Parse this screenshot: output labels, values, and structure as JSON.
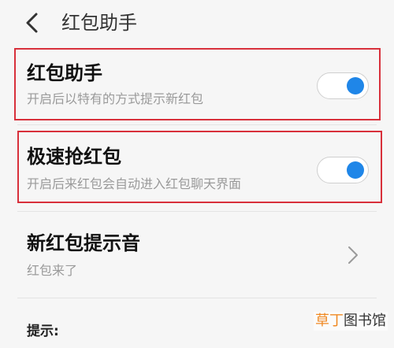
{
  "header": {
    "title": "红包助手"
  },
  "settings": [
    {
      "title": "红包助手",
      "subtitle": "开启后以特有的方式提示新红包",
      "toggle_on": true
    },
    {
      "title": "极速抢红包",
      "subtitle": "开启后来红包会自动进入红包聊天界面",
      "toggle_on": true
    },
    {
      "title": "新红包提示音",
      "subtitle": "红包来了"
    }
  ],
  "tip": {
    "label": "提示:"
  },
  "watermark": {
    "accent_text": "草丁",
    "rest_text": "图书馆"
  },
  "colors": {
    "highlight_border": "#d8303b",
    "toggle_knob": "#1f86e8",
    "watermark_accent": "#f08a24"
  },
  "icons": {
    "back": "chevron-left-icon",
    "next": "chevron-right-icon"
  }
}
